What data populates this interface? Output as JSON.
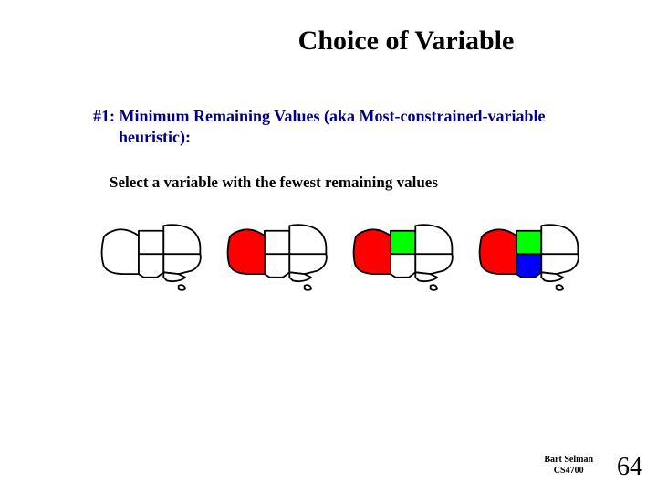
{
  "title": "Choice of Variable",
  "heading": "#1: Minimum Remaining Values (aka Most-constrained-variable heuristic):",
  "body": "Select a variable with the fewest remaining values",
  "colors": {
    "outline": "#000000",
    "uncolored": "#ffffff",
    "WA": "#ff0000",
    "NT": "#00ff00",
    "SA": "#0000ff"
  },
  "maps": [
    {
      "WA": "uncolored",
      "NT": "uncolored",
      "SA": "uncolored",
      "Q": "uncolored",
      "NSW": "uncolored",
      "V": "uncolored",
      "T": "uncolored"
    },
    {
      "WA": "WA",
      "NT": "uncolored",
      "SA": "uncolored",
      "Q": "uncolored",
      "NSW": "uncolored",
      "V": "uncolored",
      "T": "uncolored"
    },
    {
      "WA": "WA",
      "NT": "NT",
      "SA": "uncolored",
      "Q": "uncolored",
      "NSW": "uncolored",
      "V": "uncolored",
      "T": "uncolored"
    },
    {
      "WA": "WA",
      "NT": "NT",
      "SA": "SA",
      "Q": "uncolored",
      "NSW": "uncolored",
      "V": "uncolored",
      "T": "uncolored"
    }
  ],
  "footer": {
    "line1": "Bart Selman",
    "line2": "CS4700"
  },
  "page_number": "64"
}
